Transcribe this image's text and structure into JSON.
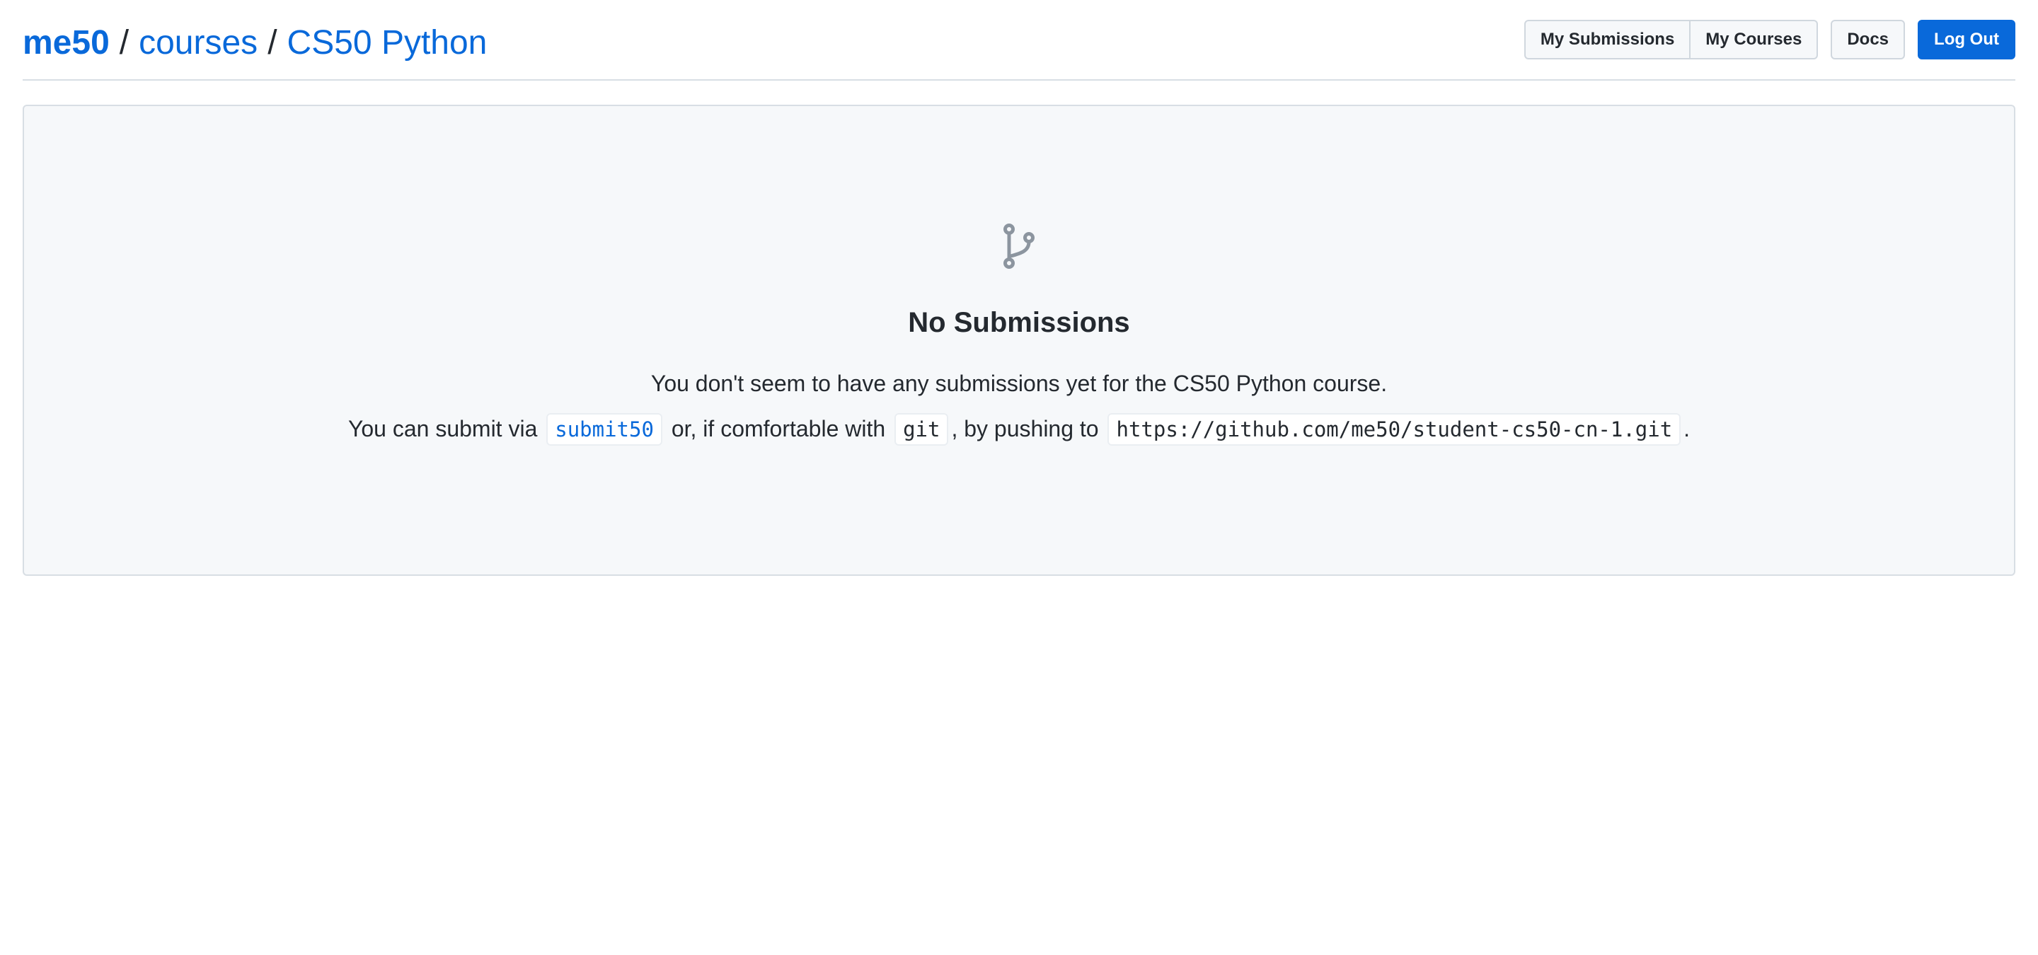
{
  "breadcrumb": {
    "owner": "me50",
    "sep1": "/",
    "section": "courses",
    "sep2": "/",
    "course": "CS50 Python"
  },
  "nav": {
    "my_submissions": "My Submissions",
    "my_courses": "My Courses",
    "docs": "Docs",
    "logout": "Log Out"
  },
  "empty_state": {
    "icon": "git-branch-icon",
    "title": "No Submissions",
    "message": "You don't seem to have any submissions yet for the CS50 Python course.",
    "instructions": {
      "prefix": "You can submit via",
      "tool": "submit50",
      "middle": "or, if comfortable with",
      "vcs": "git",
      "middle2": ", by pushing to",
      "repo_url": "https://github.com/me50/student-cs50-cn-1.git",
      "suffix": "."
    }
  },
  "colors": {
    "link": "#0969da",
    "primary_button": "#0969da",
    "panel_bg": "#f6f8fa",
    "icon": "#8c959f"
  }
}
